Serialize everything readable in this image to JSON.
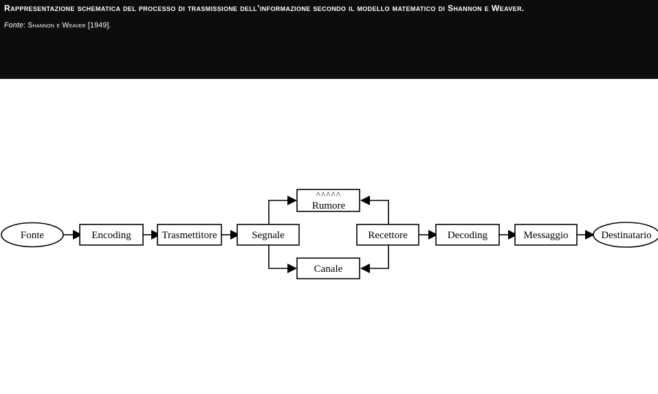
{
  "caption": {
    "title": "Rappresentazione schematica del processo di trasmissione dell’informazione secondo il modello matematico di Shannon e Weaver.",
    "source_label": "Fonte",
    "source_separator": ": ",
    "source_text": "Shannon e Weaver [1949]."
  },
  "colors": {
    "header_background": "#0d0d0d",
    "header_text": "#ffffff",
    "page_background": "#ffffff",
    "stroke": "#000000",
    "node_fill": "#ffffff"
  },
  "diagram": {
    "type": "flow",
    "title": "Modello matematico di Shannon e Weaver",
    "nodes": [
      {
        "id": "fonte",
        "label": "Fonte",
        "shape": "ellipse"
      },
      {
        "id": "encoding",
        "label": "Encoding",
        "shape": "rect"
      },
      {
        "id": "trasmettitore",
        "label": "Trasmettitore",
        "shape": "rect"
      },
      {
        "id": "segnale",
        "label": "Segnale",
        "shape": "rect"
      },
      {
        "id": "rumore",
        "label": "Rumore",
        "shape": "rect",
        "decoration": "^^^^^"
      },
      {
        "id": "canale",
        "label": "Canale",
        "shape": "rect"
      },
      {
        "id": "recettore",
        "label": "Recettore",
        "shape": "rect"
      },
      {
        "id": "decoding",
        "label": "Decoding",
        "shape": "rect"
      },
      {
        "id": "messaggio",
        "label": "Messaggio",
        "shape": "rect"
      },
      {
        "id": "destinatario",
        "label": "Destinatario",
        "shape": "ellipse"
      }
    ],
    "edges": [
      {
        "from": "fonte",
        "to": "encoding"
      },
      {
        "from": "encoding",
        "to": "trasmettitore"
      },
      {
        "from": "trasmettitore",
        "to": "segnale"
      },
      {
        "from": "segnale",
        "to": "rumore"
      },
      {
        "from": "segnale",
        "to": "canale"
      },
      {
        "from": "recettore",
        "to": "rumore"
      },
      {
        "from": "recettore",
        "to": "canale"
      },
      {
        "from": "recettore",
        "to": "decoding"
      },
      {
        "from": "decoding",
        "to": "messaggio"
      },
      {
        "from": "messaggio",
        "to": "destinatario"
      }
    ]
  }
}
